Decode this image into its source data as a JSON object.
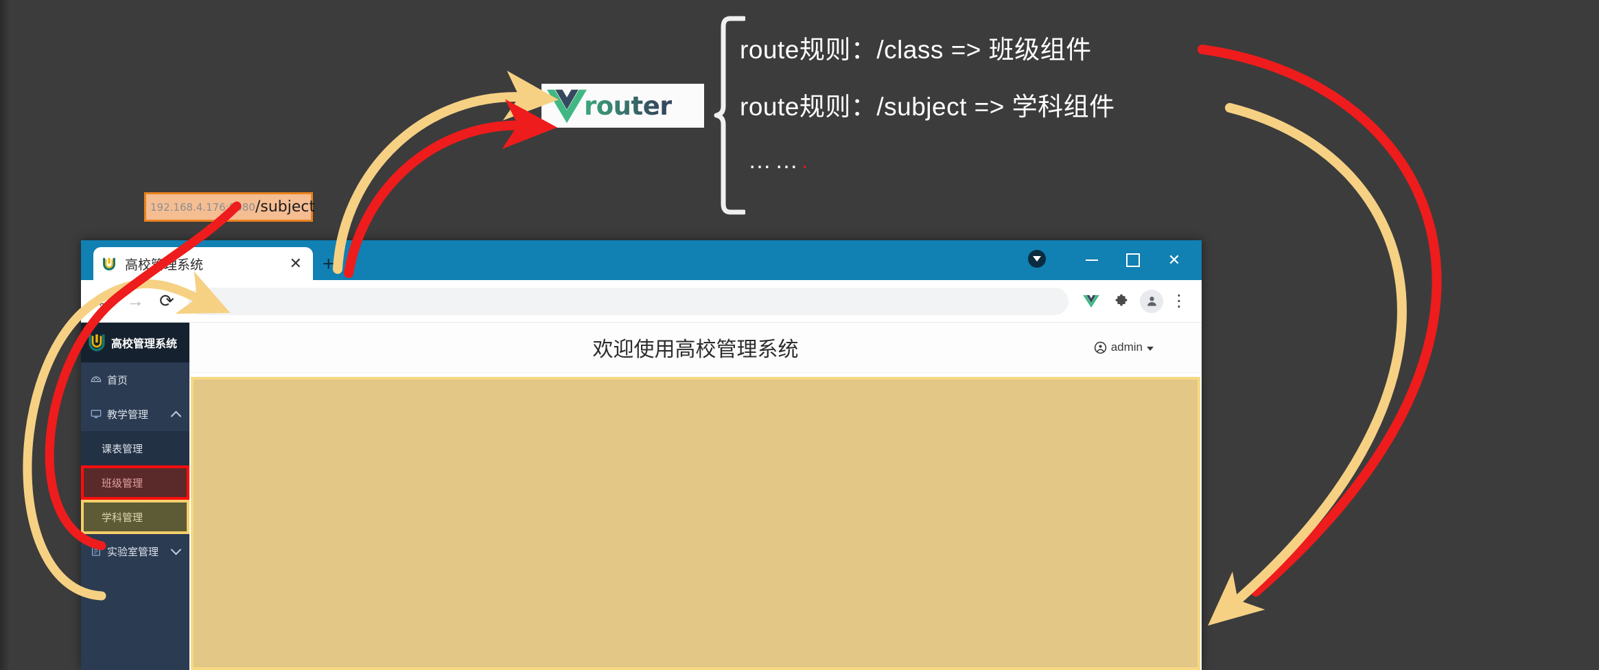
{
  "slide": {
    "background_color": "#3c3c3c",
    "router_logo": {
      "wordmark": "router",
      "mark_color_light": "#41b883",
      "mark_color_dark": "#35495e"
    },
    "route_rules": [
      "route规则：/class =>  班级组件",
      "route规则：/subject => 学科组件",
      "……"
    ],
    "annotations": {
      "red_arrow_color": "#ee1c1c",
      "yellow_arrow_color": "#f6d184",
      "red_highlight_target": "班级管理",
      "yellow_highlight_target": "学科管理"
    }
  },
  "browser": {
    "tab": {
      "title": "高校管理系统",
      "favicon": "u-logo-icon",
      "close_label": "✕",
      "new_tab_label": "+"
    },
    "window_controls": {
      "minimize": "—",
      "maximize": "▢",
      "close": "✕"
    },
    "toolbar": {
      "back": "←",
      "forward": "→",
      "reload": "⟳",
      "icons": [
        "vue-devtools-icon",
        "extensions-puzzle-icon",
        "profile-avatar-icon",
        "three-dot-menu-icon"
      ],
      "menu_dots": "⋮"
    },
    "url": {
      "host": "192.168.4.176:8080",
      "path": "/subject",
      "highlight_border": "#e8821e",
      "highlight_fill": "#f5bd92"
    }
  },
  "app": {
    "brand": "高校管理系统",
    "menu": [
      {
        "label": "首页",
        "icon": "dashboard-icon",
        "chevron": null
      },
      {
        "label": "教学管理",
        "icon": "monitor-icon",
        "chevron": "up"
      }
    ],
    "submenu": [
      {
        "label": "课表管理",
        "state": "normal"
      },
      {
        "label": "班级管理",
        "state": "red-highlight"
      },
      {
        "label": "学科管理",
        "state": "yellow-highlight"
      }
    ],
    "menu_after": [
      {
        "label": "实验室管理",
        "icon": "document-icon",
        "chevron": "down"
      }
    ],
    "header": {
      "welcome": "欢迎使用高校管理系统",
      "user": "admin",
      "user_icon": "person-circle-icon"
    },
    "content": {
      "highlight_fill": "#e2c787",
      "highlight_border": "#f7d983"
    }
  }
}
